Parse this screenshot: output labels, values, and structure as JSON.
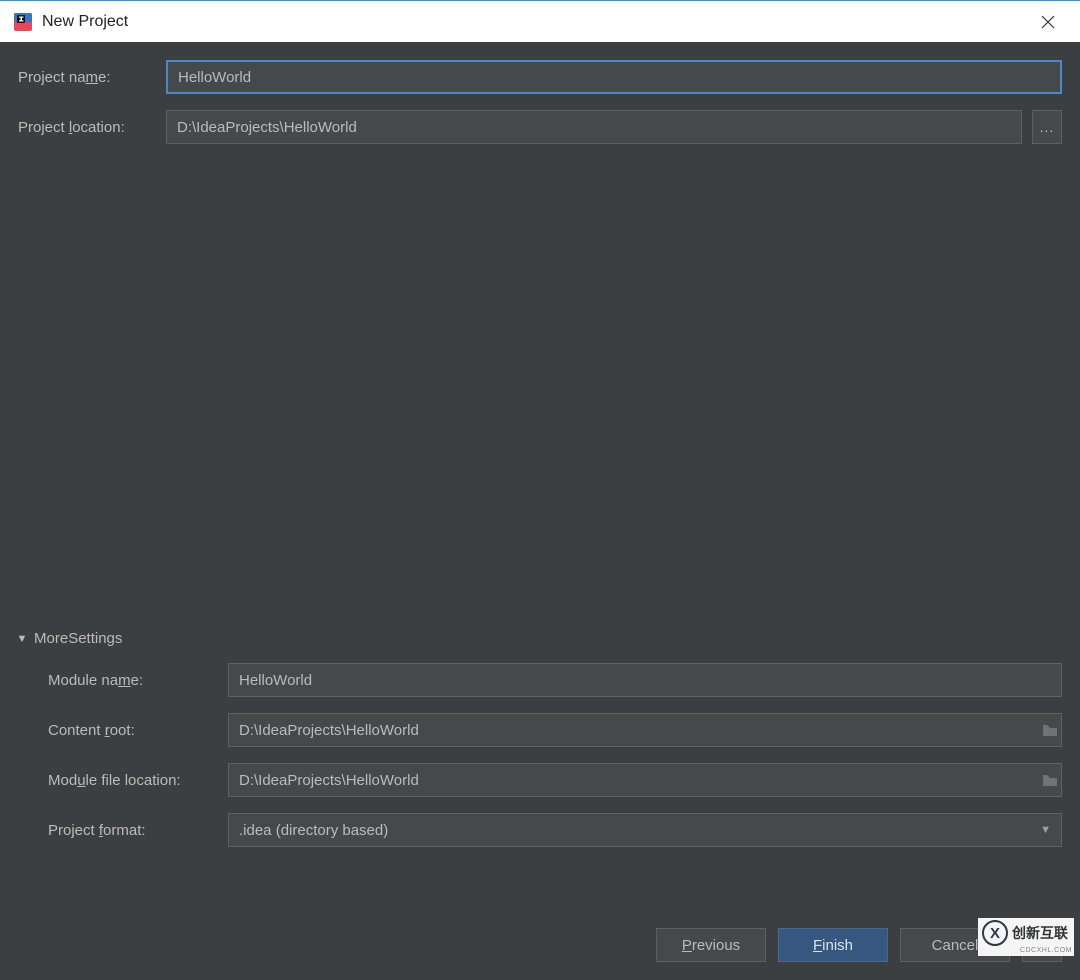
{
  "window": {
    "title": "New Project"
  },
  "form": {
    "project_name_label_pre": "Project na",
    "project_name_label_ul": "m",
    "project_name_label_post": "e:",
    "project_name_value": "HelloWorld",
    "project_location_label_pre": "Project ",
    "project_location_label_ul": "l",
    "project_location_label_post": "ocation:",
    "project_location_value": "D:\\IdeaProjects\\HelloWorld",
    "browse_label": "..."
  },
  "more": {
    "header_pre": "Mor",
    "header_ul": "e",
    "header_post": " Settings",
    "module_name_label_pre": "Module na",
    "module_name_label_ul": "m",
    "module_name_label_post": "e:",
    "module_name_value": "HelloWorld",
    "content_root_label_pre": "Content ",
    "content_root_label_ul": "r",
    "content_root_label_post": "oot:",
    "content_root_value": "D:\\IdeaProjects\\HelloWorld",
    "module_file_loc_label_pre": "Mod",
    "module_file_loc_label_ul": "u",
    "module_file_loc_label_post": "le file location:",
    "module_file_loc_value": "D:\\IdeaProjects\\HelloWorld",
    "project_format_label_pre": "Project ",
    "project_format_label_ul": "f",
    "project_format_label_post": "ormat:",
    "project_format_value": ".idea (directory based)"
  },
  "buttons": {
    "previous_ul": "P",
    "previous_post": "revious",
    "finish_ul": "F",
    "finish_post": "inish",
    "cancel": "Cancel"
  },
  "watermark": {
    "text": "创新互联",
    "sub": "CDCXHL.COM"
  }
}
